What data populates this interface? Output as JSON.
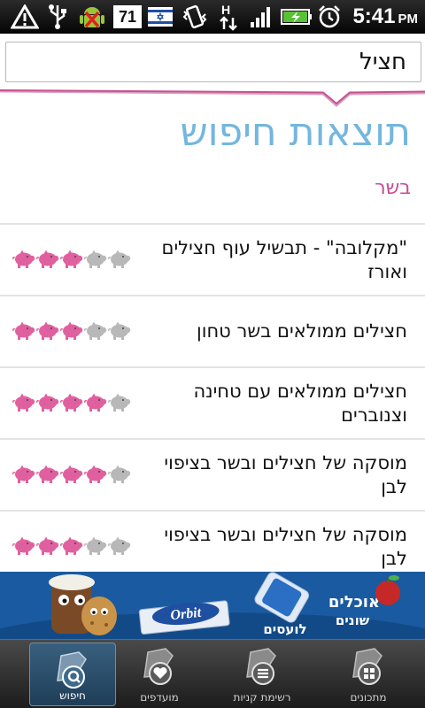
{
  "status_bar": {
    "notification_count": "71",
    "time": "5:41",
    "ampm": "PM",
    "icons": [
      "warning-icon",
      "usb-icon",
      "android-debug-icon",
      "israel-flag-icon",
      "vibrate-icon",
      "hspa-data-icon",
      "signal-icon",
      "battery-charging-icon",
      "alarm-icon"
    ]
  },
  "search": {
    "value": "חציל"
  },
  "results_title": "תוצאות חיפוש",
  "category": "בשר",
  "results": [
    {
      "title": "\"מקלובה\" - תבשיל עוף חצילים ואורז",
      "rating": 3,
      "max": 5
    },
    {
      "title": "חצילים ממולאים בשר טחון",
      "rating": 3,
      "max": 5
    },
    {
      "title": "חצילים ממולאים עם טחינה וצנוברים",
      "rating": 4,
      "max": 5
    },
    {
      "title": "מוסקה של חצילים ובשר בציפוי לבן",
      "rating": 4,
      "max": 5
    },
    {
      "title": "מוסקה של חצילים ובשר בציפוי לבן",
      "rating": 3,
      "max": 5
    }
  ],
  "banner": {
    "brand": "Orbit",
    "slogan_top": "אוכלים",
    "slogan_mid": "שונים",
    "slogan_bottom": "לועסים"
  },
  "bottom_nav": [
    {
      "label": "חיפוש",
      "icon": "search-icon",
      "active": true
    },
    {
      "label": "מועדפים",
      "icon": "heart-icon",
      "active": false
    },
    {
      "label": "רשימת קניות",
      "icon": "list-icon",
      "active": false
    },
    {
      "label": "מתכונים",
      "icon": "grid-icon",
      "active": false
    }
  ],
  "colors": {
    "title": "#74b6df",
    "category": "#c94a95",
    "pig_active": "#e0609f",
    "pig_inactive": "#b8b8b8"
  }
}
